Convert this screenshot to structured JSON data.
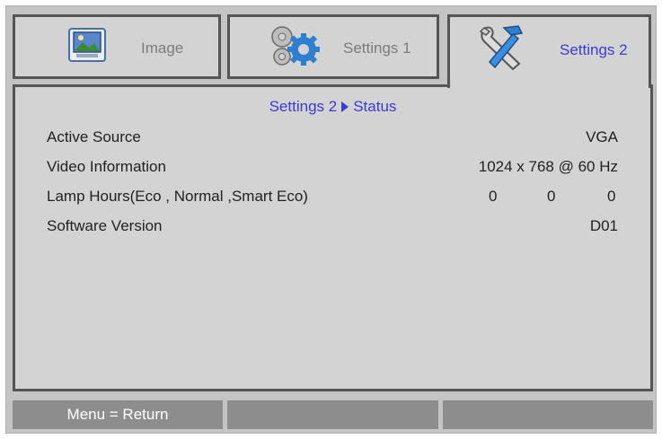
{
  "tabs": {
    "image": {
      "label": "Image",
      "icon": "image-icon"
    },
    "settings1": {
      "label": "Settings 1",
      "icon": "gears-icon"
    },
    "settings2": {
      "label": "Settings 2",
      "icon": "wrench-hammer-icon"
    }
  },
  "breadcrumb": {
    "parent": "Settings 2",
    "current": "Status"
  },
  "status_rows": {
    "active_source": {
      "label": "Active Source",
      "value": "VGA"
    },
    "video_information": {
      "label": "Video Information",
      "value": "1024 x 768 @ 60 Hz"
    },
    "lamp_hours": {
      "label": "Lamp Hours(Eco , Normal ,Smart Eco)",
      "eco": "0",
      "normal": "0",
      "smart_eco": "0"
    },
    "software_version": {
      "label": "Software Version",
      "value": "D01"
    }
  },
  "bottom_bar": {
    "hint": "Menu = Return"
  },
  "colors": {
    "frame_bg": "#c4c4c4",
    "panel_bg": "#d3d3d3",
    "accent_blue": "#3b3bd4",
    "border_dark": "#555555",
    "bar_gray": "#8d8d8d"
  }
}
